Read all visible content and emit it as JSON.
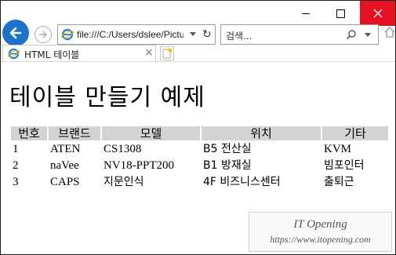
{
  "browser": {
    "address_url": "file:///C:/Users/dslee/Pictu",
    "search_placeholder": "검색...",
    "tab_title": "HTML 테이블",
    "tab_close": "×",
    "icons": [
      "back-arrow-icon",
      "forward-arrow-icon",
      "ie-icon",
      "refresh-icon",
      "search-icon",
      "home-icon",
      "new-tab-icon",
      "minimize-icon",
      "maximize-icon",
      "close-icon"
    ],
    "close_color": "#e81123",
    "back_color": "#1a73c9"
  },
  "page": {
    "heading": "테이블 만들기 예제",
    "table": {
      "headers": [
        "번호",
        "브랜드",
        "모델",
        "위치",
        "기타"
      ],
      "rows": [
        [
          "1",
          "ATEN",
          "CS1308",
          "B5 전산실",
          "KVM"
        ],
        [
          "2",
          "naVee",
          "NV18-PPT200",
          "B1 방재실",
          "빔포인터"
        ],
        [
          "3",
          "CAPS",
          "지문인식",
          "4F 비즈니스센터",
          "출퇴근"
        ]
      ],
      "header_bg": "#d3d3d3"
    },
    "watermark": {
      "title": "IT Opening",
      "url": "https://www.itopening.com"
    }
  }
}
